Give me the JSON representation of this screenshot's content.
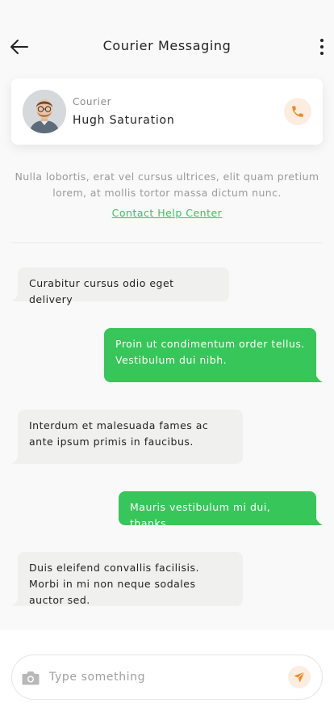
{
  "header": {
    "title": "Courier Messaging",
    "back_icon": "arrow-left-icon",
    "more_icon": "more-vertical-icon"
  },
  "courier": {
    "role": "Courier",
    "name": "Hugh Saturation",
    "call_icon": "phone-icon"
  },
  "info": {
    "text": "Nulla lobortis, erat vel cursus ultrices, elit quam pretium lorem, at mollis tortor massa dictum nunc.",
    "help_link": "Contact Help Center"
  },
  "messages": [
    {
      "direction": "incoming",
      "text": "Curabitur cursus odio eget delivery"
    },
    {
      "direction": "outgoing",
      "text": "Proin ut condimentum  order tellus. Vestibulum dui nibh."
    },
    {
      "direction": "incoming",
      "text": "Interdum et malesuada fames ac ante ipsum primis in faucibus."
    },
    {
      "direction": "outgoing",
      "text": "Mauris vestibulum mi dui, thanks"
    },
    {
      "direction": "incoming",
      "text": "Duis eleifend convallis facilisis. Morbi in mi non neque sodales auctor sed."
    }
  ],
  "composer": {
    "placeholder": "Type something",
    "camera_icon": "camera-icon",
    "send_icon": "send-icon"
  },
  "colors": {
    "accent_green": "#37c65a",
    "accent_orange": "#f08a24",
    "incoming_bubble": "#f0f0ee"
  }
}
